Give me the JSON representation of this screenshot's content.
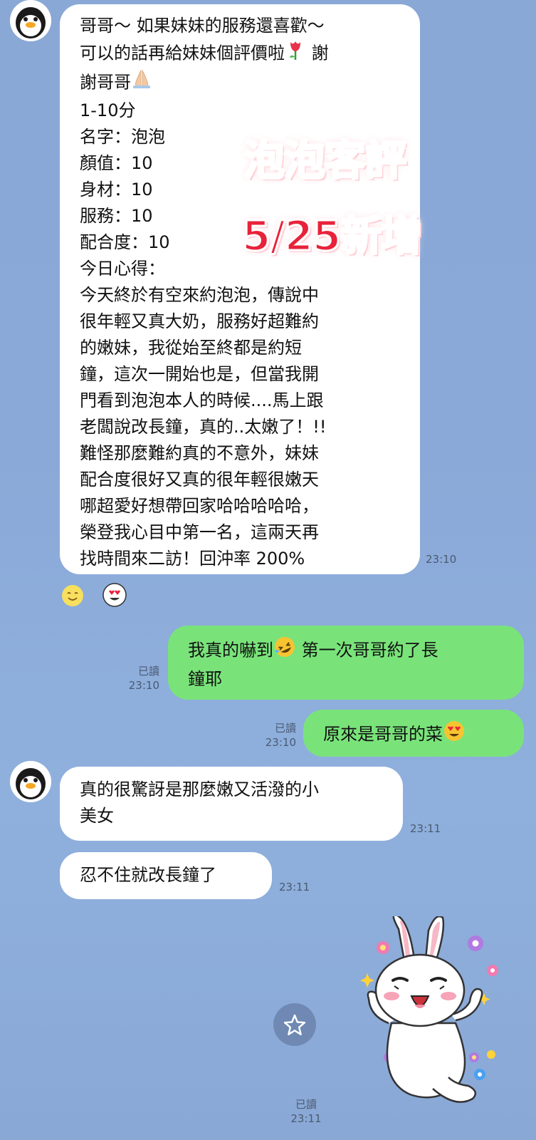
{
  "colors": {
    "background": "#8aa8d6",
    "incoming_bubble": "#ffffff",
    "outgoing_bubble": "#79e37a",
    "overlay_text": "#e8223a"
  },
  "messages": {
    "m1": {
      "sender": "incoming",
      "avatar_icon": "penguin-icon",
      "lines": [
        "哥哥～ 如果妹妹的服務還喜歡～",
        "可以的話再給妹妹個評價啦",
        "謝哥哥",
        "1-10分",
        "名字：泡泡",
        "顏值：10",
        "身材：10",
        "服務：10",
        "配合度：10",
        "今日心得：",
        "今天終於有空來約泡泡，傳說中",
        "很年輕又真大奶，服務好超難約",
        "的嫩妹，我從始至終都是約短",
        "鐘，這次一開始也是，但當我開",
        "門看到泡泡本人的時候....馬上跟",
        "老闆說改長鐘，真的..太嫩了！!!",
        "難怪那麼難約真的不意外，妹妹",
        "配合度很好又真的很年輕很嫩天",
        "哪超愛好想帶回家哈哈哈哈哈，",
        "榮登我心目中第一名，這兩天再",
        "找時間來二訪！回沖率 200%"
      ],
      "line2_trailing": "謝",
      "time": "23:10"
    },
    "m2": {
      "sender": "outgoing",
      "line1_before": "我真的嚇到",
      "line1_after": " 第一次哥哥約了長",
      "line2": "鐘耶",
      "read": "已讀",
      "time": "23:10"
    },
    "m3": {
      "sender": "outgoing",
      "text": "原來是哥哥的菜",
      "read": "已讀",
      "time": "23:10"
    },
    "m4": {
      "sender": "incoming",
      "avatar_icon": "penguin-icon",
      "lines": [
        "真的很驚訝是那麼嫩又活潑的小",
        "美女"
      ],
      "time": "23:11"
    },
    "m5": {
      "sender": "incoming",
      "text": "忍不住就改長鐘了",
      "time": "23:11"
    },
    "sticker": {
      "icon": "cony-rabbit-sticker",
      "read": "已讀",
      "time": "23:11"
    }
  },
  "reactions": [
    "smile-emoji-icon",
    "heart-eyes-emoji-icon"
  ],
  "overlay": {
    "line1": "泡泡客評",
    "line2": "5/25新增"
  },
  "controls": {
    "favorite_icon": "star-icon"
  }
}
